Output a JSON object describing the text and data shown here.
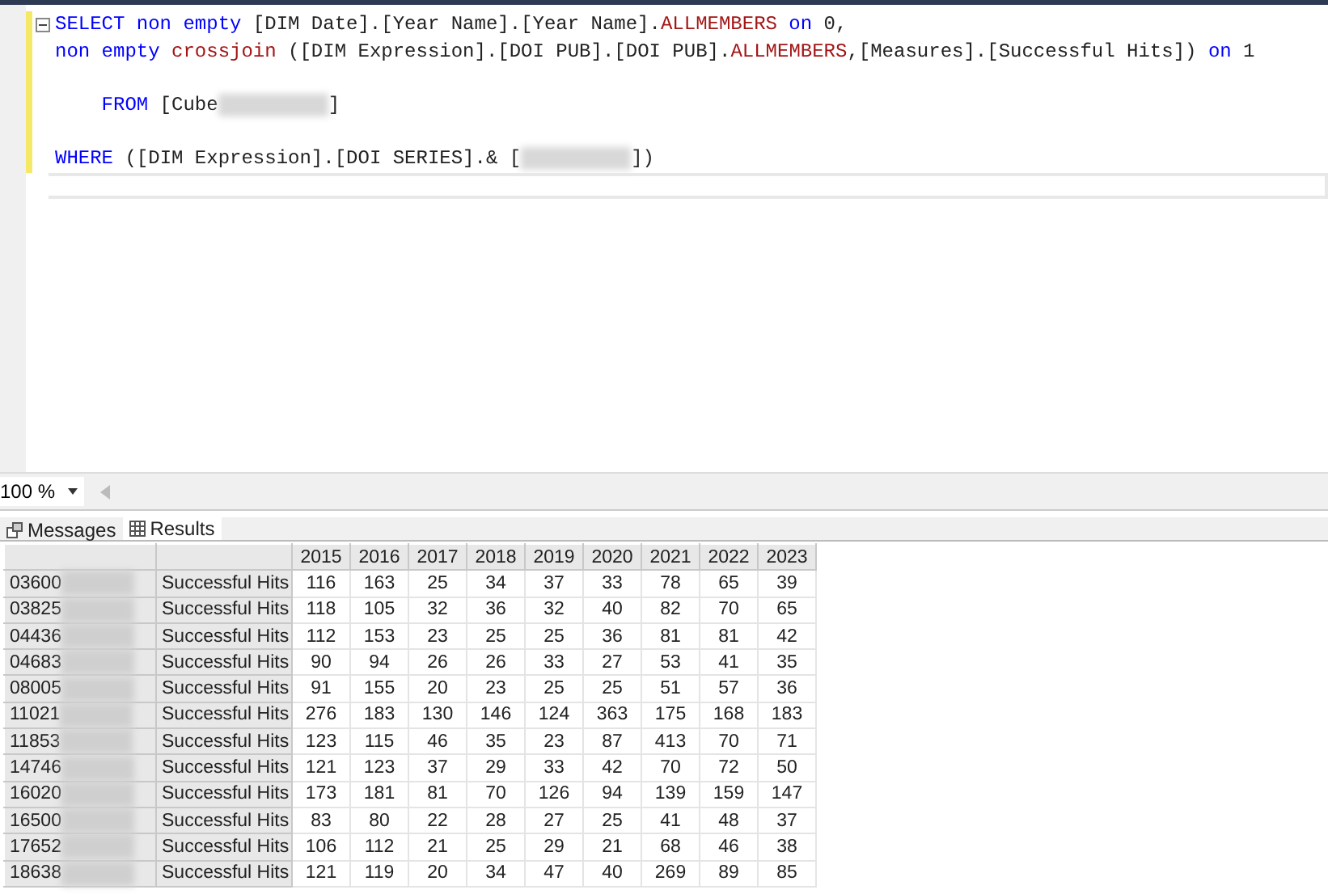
{
  "editor": {
    "lines": [
      {
        "kind": "code",
        "fold": true,
        "tokens": [
          {
            "kind": "keyword",
            "text": "SELECT non empty"
          },
          {
            "kind": "plain",
            "text": " [DIM Date].[Year Name].[Year Name]."
          },
          {
            "kind": "function",
            "text": "ALLMEMBERS"
          },
          {
            "kind": "keyword",
            "text": " on"
          },
          {
            "kind": "plain",
            "text": " 0,"
          }
        ]
      },
      {
        "kind": "code",
        "fold": false,
        "tokens": [
          {
            "kind": "keyword",
            "text": "non empty"
          },
          {
            "kind": "function",
            "text": " crossjoin"
          },
          {
            "kind": "plain",
            "text": " ([DIM Expression].[DOI PUB].[DOI PUB]."
          },
          {
            "kind": "function",
            "text": "ALLMEMBERS"
          },
          {
            "kind": "plain",
            "text": ",[Measures].[Successful Hits])"
          },
          {
            "kind": "keyword",
            "text": " on"
          },
          {
            "kind": "plain",
            "text": " 1"
          }
        ]
      },
      {
        "kind": "blank"
      },
      {
        "kind": "code",
        "fold": false,
        "tokens": [
          {
            "kind": "keyword",
            "text": "    FROM"
          },
          {
            "kind": "plain",
            "text": " [Cube"
          },
          {
            "kind": "redacted"
          },
          {
            "kind": "plain",
            "text": "]"
          }
        ]
      },
      {
        "kind": "blank"
      },
      {
        "kind": "code",
        "fold": false,
        "tokens": [
          {
            "kind": "keyword",
            "text": "WHERE"
          },
          {
            "kind": "plain",
            "text": " ([DIM Expression].[DOI SERIES].& ["
          },
          {
            "kind": "redacted"
          },
          {
            "kind": "plain",
            "text": "])"
          }
        ]
      },
      {
        "kind": "current"
      }
    ]
  },
  "zoom": {
    "value": "100 %"
  },
  "tabs": [
    {
      "label": "Messages",
      "selected": false
    },
    {
      "label": "Results",
      "selected": true
    }
  ],
  "grid": {
    "columns": [
      "2015",
      "2016",
      "2017",
      "2018",
      "2019",
      "2020",
      "2021",
      "2022",
      "2023"
    ],
    "rows": [
      {
        "id": "03600",
        "measure": "Successful Hits",
        "values": [
          "116",
          "163",
          "25",
          "34",
          "37",
          "33",
          "78",
          "65",
          "39"
        ]
      },
      {
        "id": "03825",
        "measure": "Successful Hits",
        "values": [
          "118",
          "105",
          "32",
          "36",
          "32",
          "40",
          "82",
          "70",
          "65"
        ]
      },
      {
        "id": "04436",
        "measure": "Successful Hits",
        "values": [
          "112",
          "153",
          "23",
          "25",
          "25",
          "36",
          "81",
          "81",
          "42"
        ]
      },
      {
        "id": "04683",
        "measure": "Successful Hits",
        "values": [
          "90",
          "94",
          "26",
          "26",
          "33",
          "27",
          "53",
          "41",
          "35"
        ]
      },
      {
        "id": "08005",
        "measure": "Successful Hits",
        "values": [
          "91",
          "155",
          "20",
          "23",
          "25",
          "25",
          "51",
          "57",
          "36"
        ]
      },
      {
        "id": "11021",
        "measure": "Successful Hits",
        "values": [
          "276",
          "183",
          "130",
          "146",
          "124",
          "363",
          "175",
          "168",
          "183"
        ]
      },
      {
        "id": "11853",
        "measure": "Successful Hits",
        "values": [
          "123",
          "115",
          "46",
          "35",
          "23",
          "87",
          "413",
          "70",
          "71"
        ]
      },
      {
        "id": "14746",
        "measure": "Successful Hits",
        "values": [
          "121",
          "123",
          "37",
          "29",
          "33",
          "42",
          "70",
          "72",
          "50"
        ]
      },
      {
        "id": "16020",
        "measure": "Successful Hits",
        "values": [
          "173",
          "181",
          "81",
          "70",
          "126",
          "94",
          "139",
          "159",
          "147"
        ]
      },
      {
        "id": "16500",
        "measure": "Successful Hits",
        "values": [
          "83",
          "80",
          "22",
          "28",
          "27",
          "25",
          "41",
          "48",
          "37"
        ]
      },
      {
        "id": "17652",
        "measure": "Successful Hits",
        "values": [
          "106",
          "112",
          "21",
          "25",
          "29",
          "21",
          "68",
          "46",
          "38"
        ]
      },
      {
        "id": "18638",
        "measure": "Successful Hits",
        "values": [
          "121",
          "119",
          "20",
          "34",
          "47",
          "40",
          "269",
          "89",
          "85"
        ]
      }
    ]
  }
}
